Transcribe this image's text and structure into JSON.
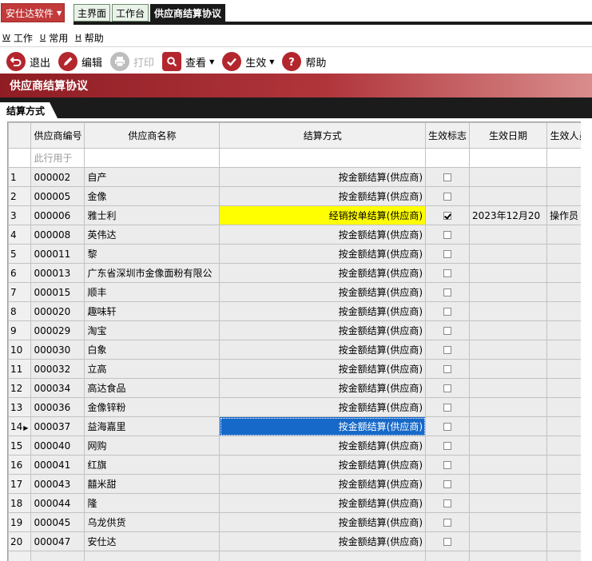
{
  "app": {
    "menu_label": "安仕达软件"
  },
  "tabs": [
    {
      "label": "主界面",
      "active": false
    },
    {
      "label": "工作台",
      "active": false
    },
    {
      "label": "供应商结算协议",
      "active": true
    }
  ],
  "menu": [
    {
      "key": "W",
      "label": "工作"
    },
    {
      "key": "U",
      "label": "常用"
    },
    {
      "key": "H",
      "label": "帮助"
    }
  ],
  "toolbar": {
    "exit": "退出",
    "edit": "编辑",
    "print": "打印",
    "view": "查看",
    "activate": "生效",
    "help": "帮助"
  },
  "page_title": "供应商结算协议",
  "section_tab": "结算方式",
  "grid": {
    "columns": [
      "",
      "供应商编号",
      "供应商名称",
      "结算方式",
      "生效标志",
      "生效日期",
      "生效人员"
    ],
    "filter_placeholder": "此行用于",
    "rows": [
      {
        "n": "1",
        "code": "000002",
        "name": "自产",
        "method": "按金额结算(供应商)",
        "checked": false,
        "date": "",
        "person": ""
      },
      {
        "n": "2",
        "code": "000005",
        "name": "金像",
        "method": "按金额结算(供应商)",
        "checked": false,
        "date": "",
        "person": ""
      },
      {
        "n": "3",
        "code": "000006",
        "name": "雅士利",
        "method": "经销按单结算(供应商)",
        "checked": true,
        "date": "2023年12月20",
        "person": "操作员",
        "highlight": "yellow"
      },
      {
        "n": "4",
        "code": "000008",
        "name": "英伟达",
        "method": "按金额结算(供应商)",
        "checked": false,
        "date": "",
        "person": ""
      },
      {
        "n": "5",
        "code": "000011",
        "name": "黎",
        "method": "按金额结算(供应商)",
        "checked": false,
        "date": "",
        "person": ""
      },
      {
        "n": "6",
        "code": "000013",
        "name": "广东省深圳市金像面粉有限公",
        "method": "按金额结算(供应商)",
        "checked": false,
        "date": "",
        "person": ""
      },
      {
        "n": "7",
        "code": "000015",
        "name": "顺丰",
        "method": "按金额结算(供应商)",
        "checked": false,
        "date": "",
        "person": ""
      },
      {
        "n": "8",
        "code": "000020",
        "name": "趣味轩",
        "method": "按金额结算(供应商)",
        "checked": false,
        "date": "",
        "person": ""
      },
      {
        "n": "9",
        "code": "000029",
        "name": "淘宝",
        "method": "按金额结算(供应商)",
        "checked": false,
        "date": "",
        "person": ""
      },
      {
        "n": "10",
        "code": "000030",
        "name": "白象",
        "method": "按金额结算(供应商)",
        "checked": false,
        "date": "",
        "person": ""
      },
      {
        "n": "11",
        "code": "000032",
        "name": "立高",
        "method": "按金额结算(供应商)",
        "checked": false,
        "date": "",
        "person": ""
      },
      {
        "n": "12",
        "code": "000034",
        "name": "高达食品",
        "method": "按金额结算(供应商)",
        "checked": false,
        "date": "",
        "person": ""
      },
      {
        "n": "13",
        "code": "000036",
        "name": "金像锌粉",
        "method": "按金额结算(供应商)",
        "checked": false,
        "date": "",
        "person": ""
      },
      {
        "n": "14",
        "code": "000037",
        "name": "益海嘉里",
        "method": "按金额结算(供应商)",
        "checked": false,
        "date": "",
        "person": "",
        "highlight": "blue",
        "current": true
      },
      {
        "n": "15",
        "code": "000040",
        "name": "网购",
        "method": "按金额结算(供应商)",
        "checked": false,
        "date": "",
        "person": ""
      },
      {
        "n": "16",
        "code": "000041",
        "name": "红旗",
        "method": "按金额结算(供应商)",
        "checked": false,
        "date": "",
        "person": ""
      },
      {
        "n": "17",
        "code": "000043",
        "name": "囍米甜",
        "method": "按金额结算(供应商)",
        "checked": false,
        "date": "",
        "person": ""
      },
      {
        "n": "18",
        "code": "000044",
        "name": "隆",
        "method": "按金额结算(供应商)",
        "checked": false,
        "date": "",
        "person": ""
      },
      {
        "n": "19",
        "code": "000045",
        "name": "乌龙供货",
        "method": "按金额结算(供应商)",
        "checked": false,
        "date": "",
        "person": ""
      },
      {
        "n": "20",
        "code": "000047",
        "name": "安仕达",
        "method": "按金额结算(供应商)",
        "checked": false,
        "date": "",
        "person": ""
      }
    ]
  },
  "colors": {
    "brand_red": "#b3262e",
    "highlight_yellow": "#ffff00",
    "selection_blue": "#1769c9"
  }
}
